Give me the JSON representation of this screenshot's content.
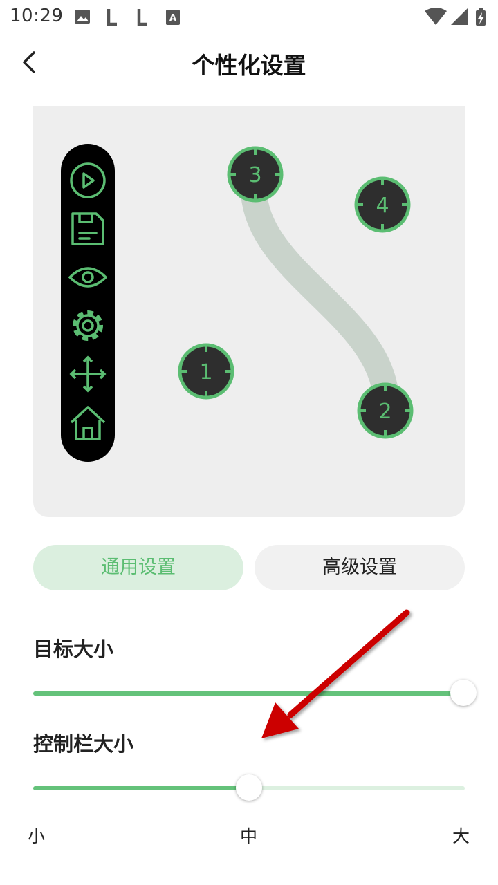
{
  "status_bar": {
    "time": "10:29",
    "left_icons": [
      "image-icon",
      "l-icon",
      "l-icon",
      "a-icon"
    ],
    "right_icons": [
      "wifi-icon",
      "signal-icon",
      "battery-charging-icon"
    ]
  },
  "header": {
    "title": "个性化设置",
    "back_icon": "chevron-left-icon"
  },
  "preview": {
    "toolbar_icons": [
      "play-icon",
      "save-icon",
      "eye-icon",
      "gear-icon",
      "move-icon",
      "home-icon"
    ],
    "targets": [
      {
        "label": "1"
      },
      {
        "label": "2"
      },
      {
        "label": "3"
      },
      {
        "label": "4"
      }
    ],
    "colors": {
      "accent": "#5bbd72",
      "target_fill": "#2e2e2e",
      "path": "#c9d3cb",
      "background": "#eeeeee"
    }
  },
  "tabs": [
    {
      "label": "通用设置",
      "active": true
    },
    {
      "label": "高级设置",
      "active": false
    }
  ],
  "settings": [
    {
      "label": "目标大小",
      "value_fraction": 1.0
    },
    {
      "label": "控制栏大小",
      "value_fraction": 0.5
    }
  ],
  "scale_labels": {
    "small": "小",
    "medium": "中",
    "large": "大"
  },
  "annotation": {
    "icon": "red-arrow-annotation",
    "color": "#cc0000"
  }
}
